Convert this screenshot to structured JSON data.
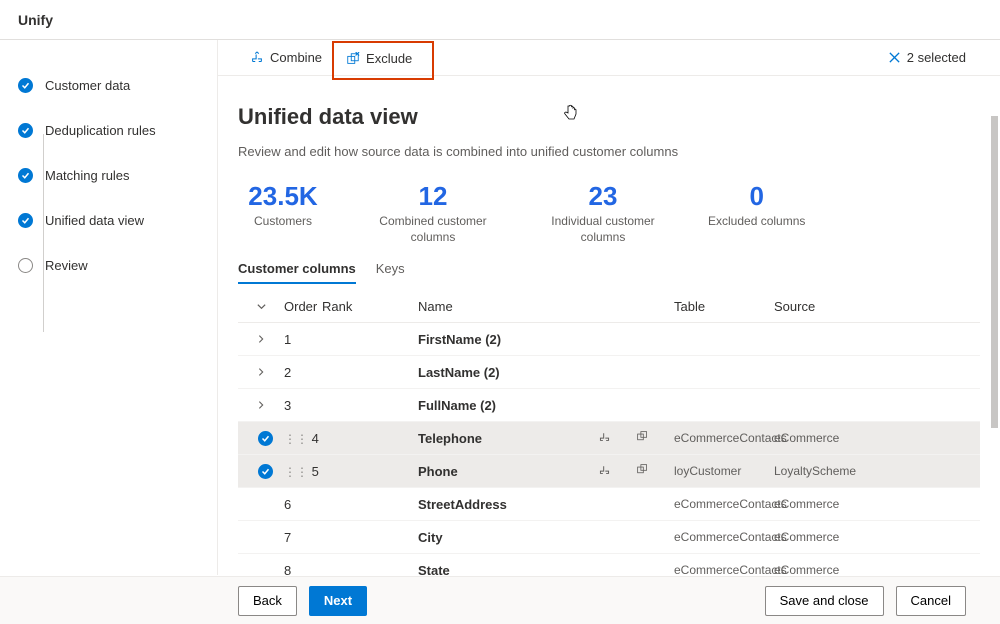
{
  "app_title": "Unify",
  "sidebar": {
    "items": [
      {
        "label": "Customer data",
        "done": true
      },
      {
        "label": "Deduplication rules",
        "done": true
      },
      {
        "label": "Matching rules",
        "done": true
      },
      {
        "label": "Unified data view",
        "done": true
      },
      {
        "label": "Review",
        "done": false
      }
    ]
  },
  "toolbar": {
    "combine": "Combine",
    "exclude": "Exclude",
    "selected_count": "2 selected"
  },
  "page": {
    "title": "Unified data view",
    "subtitle": "Review and edit how source data is combined into unified customer columns"
  },
  "stats": [
    {
      "value": "23.5K",
      "label": "Customers"
    },
    {
      "value": "12",
      "label": "Combined customer columns"
    },
    {
      "value": "23",
      "label": "Individual customer columns"
    },
    {
      "value": "0",
      "label": "Excluded columns"
    }
  ],
  "tabs": {
    "customer_columns": "Customer columns",
    "keys": "Keys"
  },
  "columns": {
    "order": "Order",
    "rank": "Rank",
    "name": "Name",
    "table": "Table",
    "source": "Source"
  },
  "rows": [
    {
      "selected": false,
      "expandable": true,
      "order": "1",
      "rank": "",
      "name": "FirstName (2)",
      "table": "",
      "source": ""
    },
    {
      "selected": false,
      "expandable": true,
      "order": "2",
      "rank": "",
      "name": "LastName (2)",
      "table": "",
      "source": ""
    },
    {
      "selected": false,
      "expandable": true,
      "order": "3",
      "rank": "",
      "name": "FullName (2)",
      "table": "",
      "source": ""
    },
    {
      "selected": true,
      "expandable": false,
      "order": "4",
      "rank": "",
      "name": "Telephone",
      "table": "eCommerceContacts",
      "source": "eCommerce",
      "icons": true
    },
    {
      "selected": true,
      "expandable": false,
      "order": "5",
      "rank": "",
      "name": "Phone",
      "table": "loyCustomer",
      "source": "LoyaltyScheme",
      "icons": true
    },
    {
      "selected": false,
      "expandable": false,
      "order": "6",
      "rank": "",
      "name": "StreetAddress",
      "table": "eCommerceContacts",
      "source": "eCommerce"
    },
    {
      "selected": false,
      "expandable": false,
      "order": "7",
      "rank": "",
      "name": "City",
      "table": "eCommerceContacts",
      "source": "eCommerce"
    },
    {
      "selected": false,
      "expandable": false,
      "order": "8",
      "rank": "",
      "name": "State",
      "table": "eCommerceContacts",
      "source": "eCommerce"
    }
  ],
  "footer": {
    "back": "Back",
    "next": "Next",
    "save_close": "Save and close",
    "cancel": "Cancel"
  }
}
